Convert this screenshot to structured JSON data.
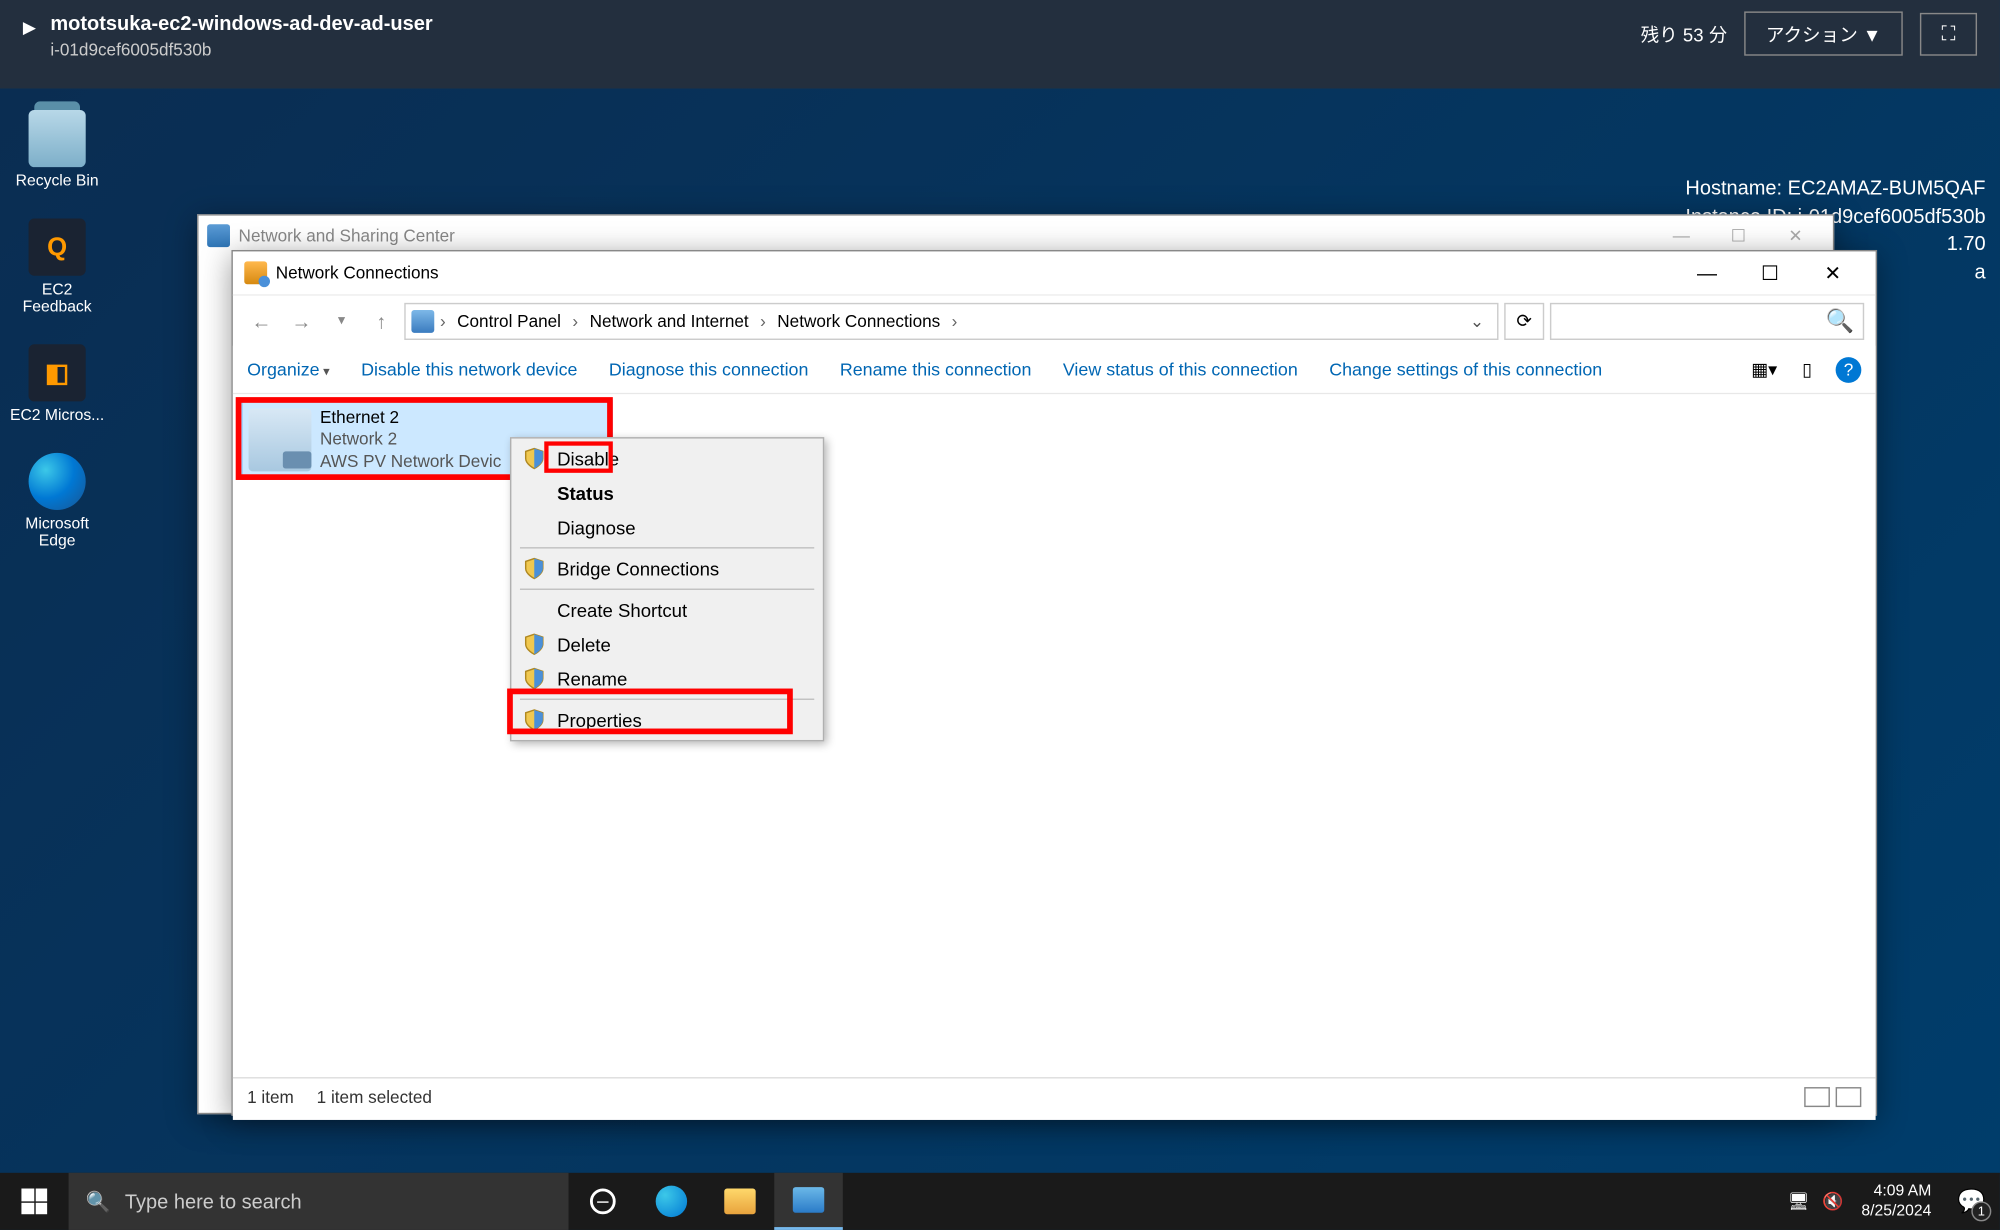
{
  "aws": {
    "title": "mototsuka-ec2-windows-ad-dev-ad-user",
    "instance_id": "i-01d9cef6005df530b",
    "remaining": "残り 53 分",
    "action_btn": "アクション ▼"
  },
  "overlay": {
    "l1": "Hostname: EC2AMAZ-BUM5QAF",
    "l2": "Instance ID: i-01d9cef6005df530b",
    "l3": "1.70",
    "l4": "a"
  },
  "desktop_icons": {
    "recycle": "Recycle Bin",
    "ec2feedback": "EC2 Feedback",
    "ec2micro": "EC2 Micros...",
    "edge": "Microsoft Edge"
  },
  "win1": {
    "title": "Network and Sharing Center"
  },
  "win2": {
    "title": "Network Connections",
    "breadcrumbs": {
      "cp": "Control Panel",
      "ni": "Network and Internet",
      "nc": "Network Connections"
    },
    "toolbar": {
      "organize": "Organize",
      "disable": "Disable this network device",
      "diagnose": "Diagnose this connection",
      "rename": "Rename this connection",
      "viewstatus": "View status of this connection",
      "changesettings": "Change settings of this connection"
    },
    "connection": {
      "name": "Ethernet 2",
      "network": "Network 2",
      "device": "AWS PV Network Devic"
    },
    "context_menu": {
      "disable": "Disable",
      "status": "Status",
      "diagnose": "Diagnose",
      "bridge": "Bridge Connections",
      "shortcut": "Create Shortcut",
      "delete": "Delete",
      "rename": "Rename",
      "properties": "Properties"
    },
    "status_bar": {
      "count": "1 item",
      "selected": "1 item selected"
    }
  },
  "taskbar": {
    "search_placeholder": "Type here to search",
    "clock_time": "4:09 AM",
    "clock_date": "8/25/2024",
    "notif_count": "1"
  }
}
